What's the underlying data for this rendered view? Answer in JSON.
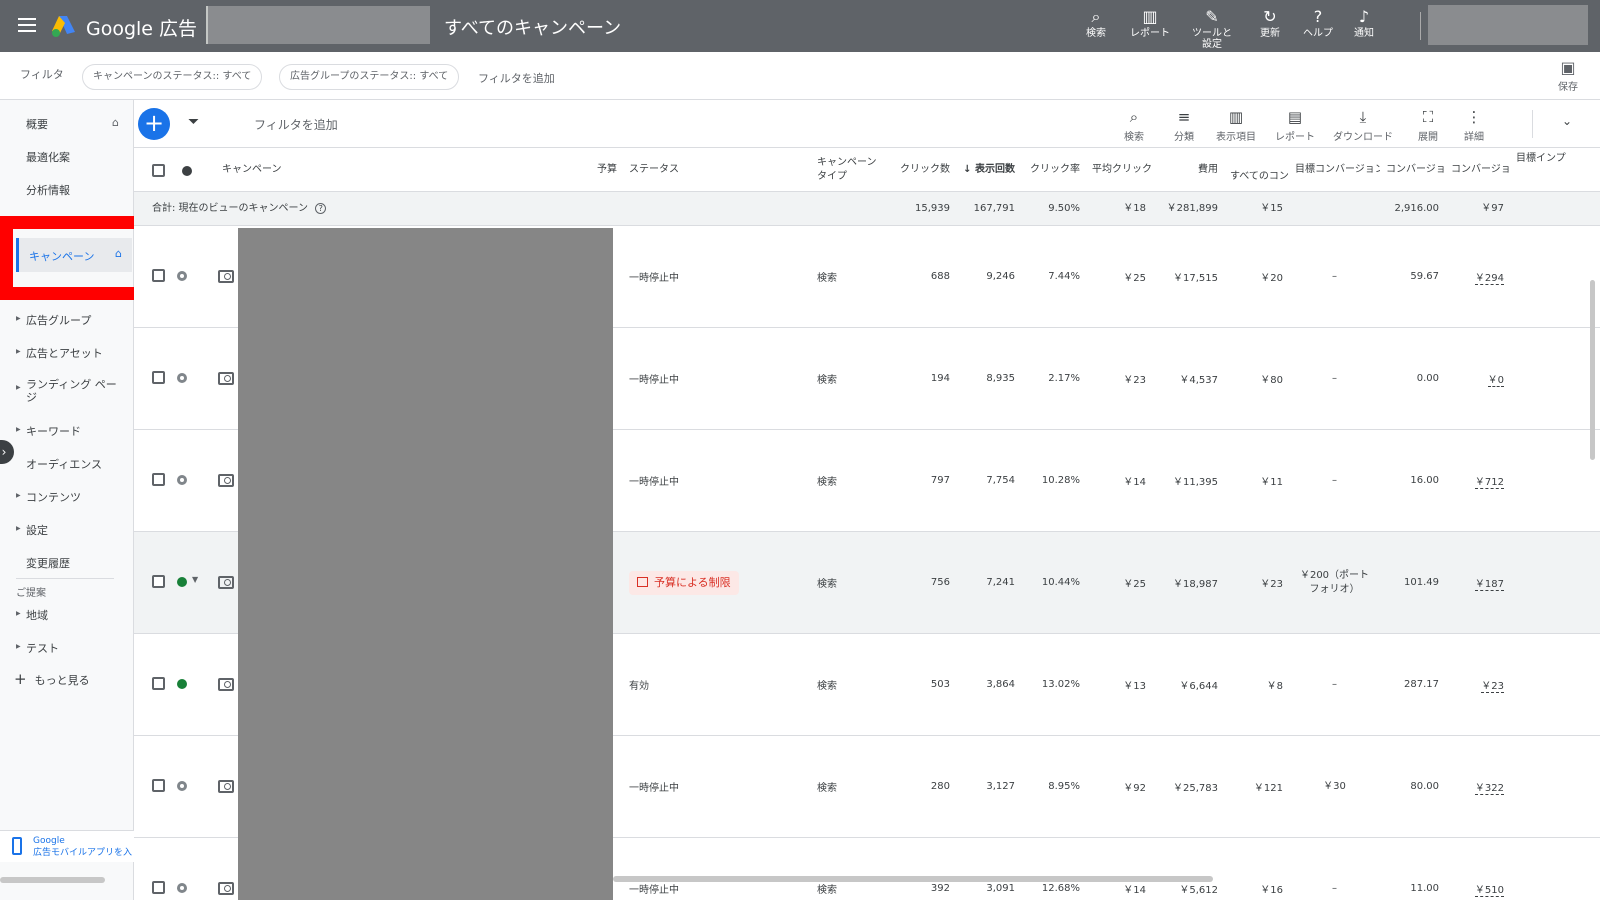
{
  "header": {
    "brand": "Google 広告",
    "page_title": "すべてのキャンペーン",
    "buttons": [
      {
        "icon": "search-icon",
        "label": "検索"
      },
      {
        "icon": "report-icon",
        "label": "レポート"
      },
      {
        "icon": "wrench-icon",
        "label": "ツールと設定"
      },
      {
        "icon": "refresh-icon",
        "label": "更新"
      },
      {
        "icon": "help-icon",
        "label": "ヘルプ"
      },
      {
        "icon": "bell-icon",
        "label": "通知"
      }
    ]
  },
  "filterbar": {
    "label": "フィルタ",
    "chips": [
      "キャンペーンのステータス:: すべて",
      "広告グループのステータス:: すべて"
    ],
    "add_filter": "フィルタを追加",
    "save_label": "保存"
  },
  "sidebar": {
    "items": [
      {
        "label": "概要",
        "arrow": false
      },
      {
        "label": "最適化案",
        "arrow": false
      },
      {
        "label": "分析情報",
        "arrow": false
      },
      {
        "label": "キャンペーン",
        "arrow": false
      },
      {
        "label": "広告グループ",
        "arrow": true
      },
      {
        "label": "広告とアセット",
        "arrow": true
      },
      {
        "label": "ランディング ページ",
        "arrow": true
      },
      {
        "label": "キーワード",
        "arrow": true
      },
      {
        "label": "オーディエンス",
        "arrow": false
      },
      {
        "label": "コンテンツ",
        "arrow": true
      },
      {
        "label": "設定",
        "arrow": true
      },
      {
        "label": "変更履歴",
        "arrow": false
      },
      {
        "label": "地域",
        "arrow": true
      },
      {
        "label": "テスト",
        "arrow": true
      }
    ],
    "section_label": "ご提案",
    "more_label": "もっと見る",
    "mobile_line1": "Google",
    "mobile_line2": "広告モバイルアプリを入"
  },
  "toolbar": {
    "add_filter": "フィルタを追加",
    "buttons": [
      {
        "icon": "search-icon",
        "label": "検索"
      },
      {
        "icon": "segment-icon",
        "label": "分類"
      },
      {
        "icon": "columns-icon",
        "label": "表示項目"
      },
      {
        "icon": "report-icon",
        "label": "レポート"
      },
      {
        "icon": "download-icon",
        "label": "ダウンロード"
      },
      {
        "icon": "expand-icon",
        "label": "展開"
      },
      {
        "icon": "more-vert-icon",
        "label": "詳細"
      }
    ]
  },
  "table": {
    "headers": {
      "campaign": "キャンペーン",
      "budget": "予算",
      "status": "ステータス",
      "type": "キャンペーンタイプ",
      "clicks": "クリック数",
      "impressions": "↓ 表示回数",
      "ctr": "クリック率",
      "avg_cpc": "平均クリック",
      "cost": "費用",
      "all_conv_cost": "すべてのコンバ",
      "target_cpa": "目標コンバージョン",
      "conversions": "コンバージョン",
      "cost_per_conv": "コンバージョン",
      "target_impr": "目標インプ"
    },
    "totals": {
      "label": "合計: 現在のビューのキャンペーン",
      "clicks": "15,939",
      "impressions": "167,791",
      "ctr": "9.50%",
      "avg_cpc": "￥18",
      "cost": "￥281,899",
      "all_conv_cost": "￥15",
      "conversions": "2,916.00",
      "cost_per_conv": "￥97"
    },
    "rows": [
      {
        "status": "一時停止中",
        "status_color": "gray",
        "type": "検索",
        "clicks": "688",
        "impressions": "9,246",
        "ctr": "7.44%",
        "avg_cpc": "￥25",
        "cost": "￥17,515",
        "all_conv_cost": "￥20",
        "target_cpa": "–",
        "conversions": "59.67",
        "cost_per_conv": "￥294"
      },
      {
        "status": "一時停止中",
        "status_color": "gray",
        "type": "検索",
        "clicks": "194",
        "impressions": "8,935",
        "ctr": "2.17%",
        "avg_cpc": "￥23",
        "cost": "￥4,537",
        "all_conv_cost": "￥80",
        "target_cpa": "–",
        "conversions": "0.00",
        "cost_per_conv": "￥0"
      },
      {
        "status": "一時停止中",
        "status_color": "gray",
        "type": "検索",
        "clicks": "797",
        "impressions": "7,754",
        "ctr": "10.28%",
        "avg_cpc": "￥14",
        "cost": "￥11,395",
        "all_conv_cost": "￥11",
        "target_cpa": "–",
        "conversions": "16.00",
        "cost_per_conv": "￥712"
      },
      {
        "status": "予算による制限",
        "status_color": "green",
        "type": "検索",
        "clicks": "756",
        "impressions": "7,241",
        "ctr": "10.44%",
        "avg_cpc": "￥25",
        "cost": "￥18,987",
        "all_conv_cost": "￥23",
        "target_cpa": "￥200（ポートフォリオ）",
        "conversions": "101.49",
        "cost_per_conv": "￥187"
      },
      {
        "status": "有効",
        "status_color": "green",
        "type": "検索",
        "clicks": "503",
        "impressions": "3,864",
        "ctr": "13.02%",
        "avg_cpc": "￥13",
        "cost": "￥6,644",
        "all_conv_cost": "￥8",
        "target_cpa": "–",
        "conversions": "287.17",
        "cost_per_conv": "￥23"
      },
      {
        "status": "一時停止中",
        "status_color": "gray",
        "type": "検索",
        "clicks": "280",
        "impressions": "3,127",
        "ctr": "8.95%",
        "avg_cpc": "￥92",
        "cost": "￥25,783",
        "all_conv_cost": "￥121",
        "target_cpa": "￥30",
        "conversions": "80.00",
        "cost_per_conv": "￥322"
      },
      {
        "status": "一時停止中",
        "status_color": "gray",
        "type": "検索",
        "clicks": "392",
        "impressions": "3,091",
        "ctr": "12.68%",
        "avg_cpc": "￥14",
        "cost": "￥5,612",
        "all_conv_cost": "￥16",
        "target_cpa": "–",
        "conversions": "11.00",
        "cost_per_conv": "￥510"
      }
    ]
  },
  "colors": {
    "topbar": "#5f6368",
    "accent": "#1a73e8",
    "highlight_box": "#ff0000",
    "enabled": "#188038",
    "limited": "#d93025"
  }
}
